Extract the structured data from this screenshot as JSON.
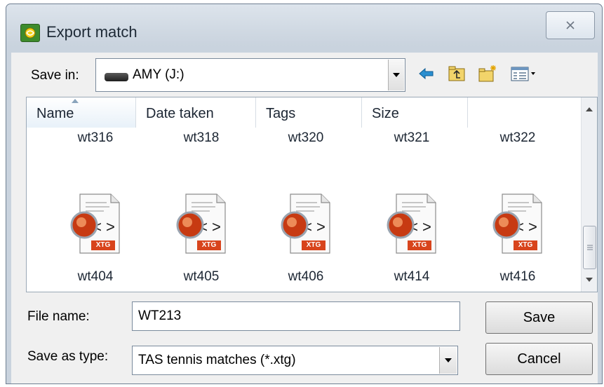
{
  "window": {
    "title": "Export match"
  },
  "toolbar": {
    "save_in_label": "Save in:",
    "save_in_value": "AMY (J:)"
  },
  "file_list": {
    "columns": [
      "Name",
      "Date taken",
      "Tags",
      "Size"
    ],
    "more_columns": "»",
    "top_row": [
      "wt316",
      "wt318",
      "wt320",
      "wt321",
      "wt322"
    ],
    "items": [
      {
        "name": "wt404",
        "badge": "XTG",
        "icon": "xtg-file-icon"
      },
      {
        "name": "wt405",
        "badge": "XTG",
        "icon": "xtg-file-icon"
      },
      {
        "name": "wt406",
        "badge": "XTG",
        "icon": "xtg-file-icon"
      },
      {
        "name": "wt414",
        "badge": "XTG",
        "icon": "xtg-file-icon"
      },
      {
        "name": "wt416",
        "badge": "XTG",
        "icon": "xtg-file-icon"
      }
    ]
  },
  "form": {
    "file_name_label": "File name:",
    "file_name_value": "WT213",
    "save_type_label": "Save as type:",
    "save_type_value": "TAS tennis matches (*.xtg)"
  },
  "buttons": {
    "save": "Save",
    "cancel": "Cancel"
  },
  "colors": {
    "accent": "#3d8b2c",
    "badge": "#d8441c",
    "window_bg": "#f0f0f0"
  }
}
